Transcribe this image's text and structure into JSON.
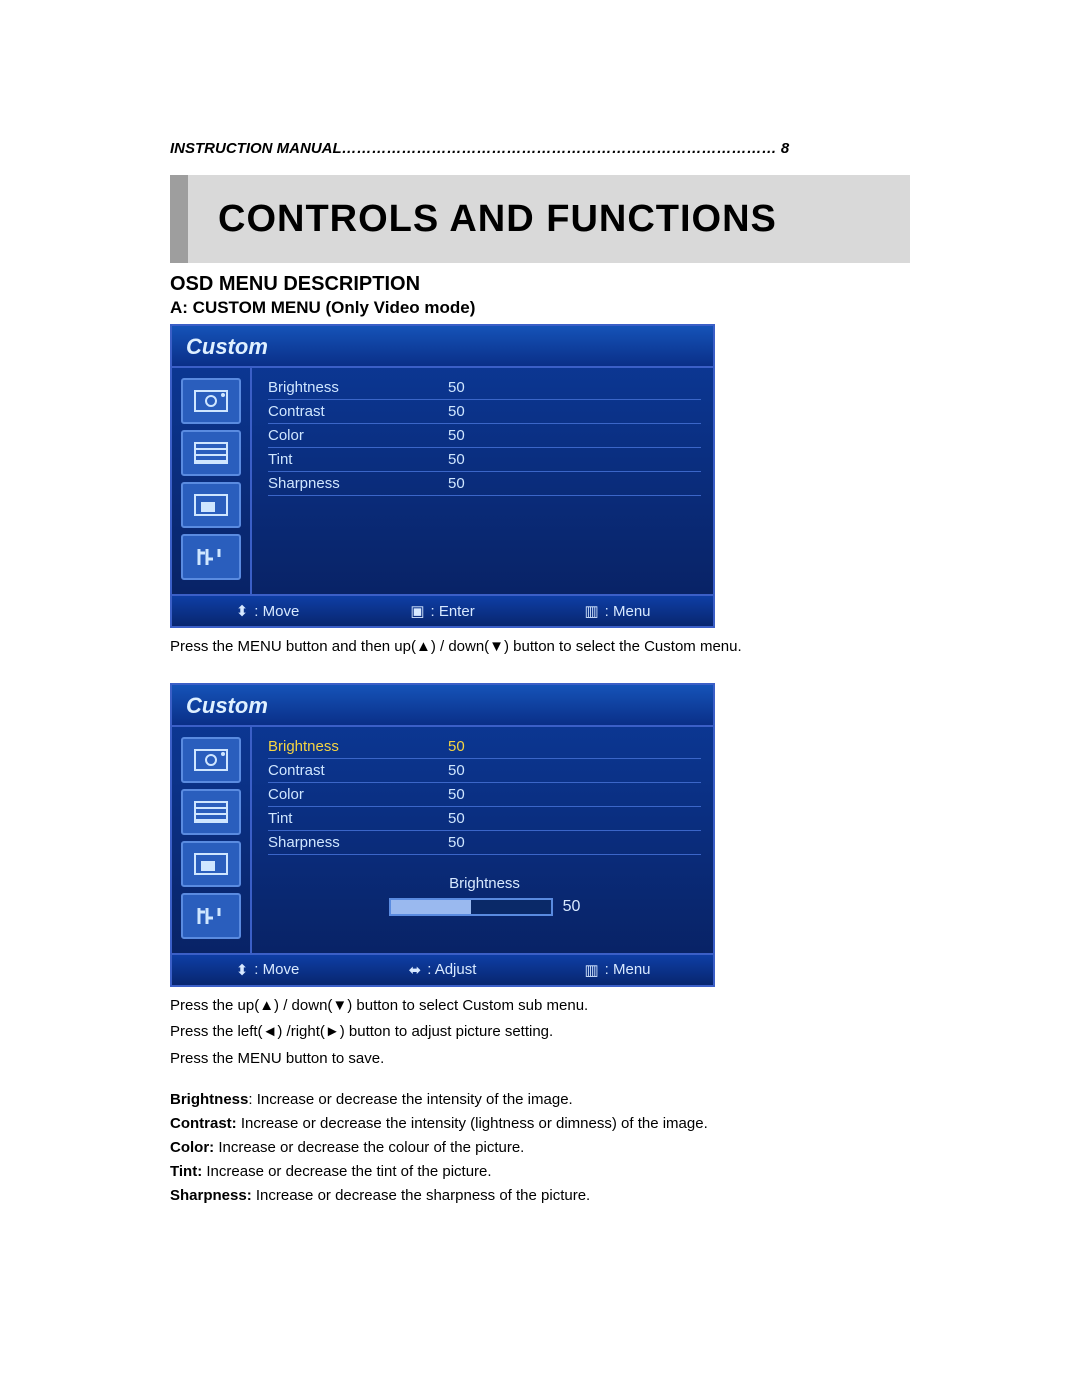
{
  "header": {
    "line": "INSTRUCTION MANUAL…………………………………………………………………………… 8"
  },
  "banner": {
    "title": "CONTROLS AND FUNCTIONS"
  },
  "titles": {
    "osd": "OSD MENU DESCRIPTION",
    "sub": "A: CUSTOM MENU (Only Video mode)"
  },
  "menu1": {
    "title": "Custom",
    "rows": [
      {
        "label": "Brightness",
        "value": "50"
      },
      {
        "label": "Contrast",
        "value": "50"
      },
      {
        "label": "Color",
        "value": "50"
      },
      {
        "label": "Tint",
        "value": "50"
      },
      {
        "label": "Sharpness",
        "value": "50"
      }
    ],
    "footer": {
      "move": ": Move",
      "enter": ": Enter",
      "menu": ": Menu"
    }
  },
  "text1": "Press the MENU button and then up(▲) / down(▼) button to select the Custom menu.",
  "menu2": {
    "title": "Custom",
    "rows": [
      {
        "label": "Brightness",
        "value": "50",
        "selected": true
      },
      {
        "label": "Contrast",
        "value": "50"
      },
      {
        "label": "Color",
        "value": "50"
      },
      {
        "label": "Tint",
        "value": "50"
      },
      {
        "label": "Sharpness",
        "value": "50"
      }
    ],
    "adjuster": {
      "label": "Brightness",
      "value": "50"
    },
    "footer": {
      "move": ": Move",
      "adjust": ": Adjust",
      "menu": ": Menu"
    }
  },
  "text2": "Press the up(▲) / down(▼) button to select Custom sub menu.",
  "text3": "Press the left(◄) /right(►) button to adjust picture setting.",
  "text4": "Press the MENU button to save.",
  "defs": {
    "brightness": {
      "term": "Brightness",
      "desc": ": Increase or decrease the intensity of the image."
    },
    "contrast": {
      "term": "Contrast:",
      "desc": " Increase or decrease the intensity (lightness or dimness) of the image."
    },
    "color": {
      "term": "Color:",
      "desc": " Increase or decrease the colour of the picture."
    },
    "tint": {
      "term": "Tint:",
      "desc": " Increase or decrease the tint of the picture."
    },
    "sharpness": {
      "term": "Sharpness:",
      "desc": " Increase or decrease the sharpness of the picture."
    }
  },
  "icons": {
    "updown": "↕",
    "leftright": "↔",
    "square": "▣",
    "menu": "▥"
  }
}
